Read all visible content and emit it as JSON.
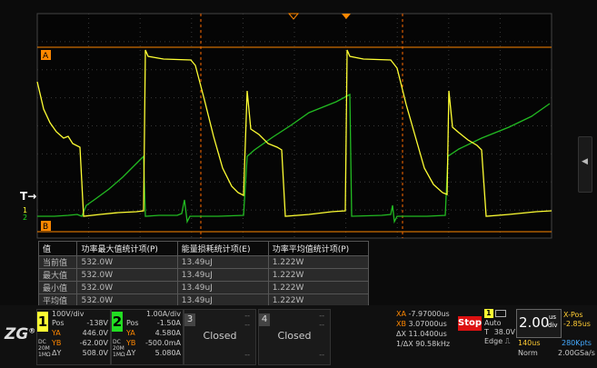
{
  "colors": {
    "ch1": "#ffff33",
    "ch2": "#22dd22",
    "grid": "#3a3a3a",
    "orange": "#ff8800",
    "stop": "#dd1111"
  },
  "markers": {
    "a": "A",
    "b": "B",
    "trigger": "T"
  },
  "table": {
    "headers": [
      "值",
      "功率最大值统计项(P)",
      "能量损耗统计项(E)",
      "功率平均值统计项(P)"
    ],
    "rows": [
      [
        "当前值",
        "532.0W",
        "13.49uJ",
        "1.222W"
      ],
      [
        "最大值",
        "532.0W",
        "13.49uJ",
        "1.222W"
      ],
      [
        "最小值",
        "532.0W",
        "13.49uJ",
        "1.222W"
      ],
      [
        "平均值",
        "532.0W",
        "13.49uJ",
        "1.222W"
      ]
    ]
  },
  "logo": {
    "text": "ZG",
    "mark": "®"
  },
  "ch1": {
    "num": "1",
    "scale": "100V/div",
    "pos_label": "Pos",
    "pos": "-138V",
    "ya_label": "YA",
    "ya": "446.0V",
    "yb_label": "YB",
    "yb": "-62.00V",
    "dy_label": "ΔY",
    "dy": "508.0V",
    "cpl": "DC",
    "bw": "20M",
    "imp": "1MΩ"
  },
  "ch2": {
    "num": "2",
    "scale": "1.00A/div",
    "pos_label": "Pos",
    "pos": "-1.50A",
    "ya_label": "YA",
    "ya": "4.580A",
    "yb_label": "YB",
    "yb": "-500.0mA",
    "dy_label": "ΔY",
    "dy": "5.080A",
    "cpl": "DC",
    "bw": "20M",
    "imp": "1MΩ"
  },
  "ch3": {
    "num": "3",
    "state": "Closed",
    "dash": "--"
  },
  "ch4": {
    "num": "4",
    "state": "Closed",
    "dash": "--"
  },
  "cursor": {
    "xa_label": "XA",
    "xa": "-7.97000us",
    "xb_label": "XB",
    "xb": "3.07000us",
    "dx_label": "ΔX",
    "dx": "11.0400us",
    "inv_label": "1/ΔX",
    "inv": "90.58kHz"
  },
  "run": {
    "status": "Stop"
  },
  "trigger": {
    "src": "1",
    "mode": "Auto",
    "label": "T",
    "level": "38.0V",
    "type": "Edge"
  },
  "timebase": {
    "scale": "2.00",
    "unit_top": "us",
    "unit_bottom": "div",
    "xpos_label": "X-Pos",
    "xpos": "-2.85us",
    "mem": "140us",
    "pts": "280Kpts",
    "acq": "Norm",
    "rate": "2.00GSa/s"
  }
}
